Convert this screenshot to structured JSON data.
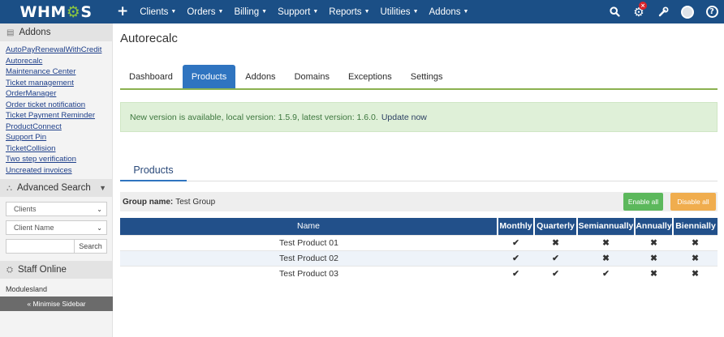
{
  "topbar": {
    "logo_prefix": "WHM",
    "logo_gear": "⚙",
    "logo_suffix": "S",
    "plus": "+",
    "menu": [
      {
        "label": "Clients",
        "caret": "▼"
      },
      {
        "label": "Orders",
        "caret": "▼"
      },
      {
        "label": "Billing",
        "caret": "▼"
      },
      {
        "label": "Support",
        "caret": "▼"
      },
      {
        "label": "Reports",
        "caret": "▼"
      },
      {
        "label": "Utilities",
        "caret": "▼"
      },
      {
        "label": "Addons",
        "caret": "▼"
      }
    ],
    "icons": [
      "search-icon",
      "gear-icon",
      "wrench-icon",
      "avatar",
      "help-icon"
    ],
    "search_glyph": "⚲",
    "gear_glyph": "⚙",
    "wrench_glyph": "✎",
    "help_glyph": "?",
    "notification_badge": "×"
  },
  "sidebar": {
    "addons_title": "Addons",
    "addons_icon": "▤",
    "addons": [
      "AutoPayRenewalWithCredit",
      "Autorecalc",
      "Maintenance Center",
      "Ticket management",
      "OrderManager",
      "Order ticket notification",
      "Ticket Payment Reminder",
      "ProductConnect",
      "Support Pin",
      "TicketCollision",
      "Two step verification",
      "Uncreated invoices"
    ],
    "advanced_search_title": "Advanced Search",
    "advanced_search_icon": "⛬",
    "collapse_glyph": "▼",
    "search_type": "Clients",
    "search_field": "Client Name",
    "dropdown_glyph": "⌄",
    "search_button": "Search",
    "staff_title": "Staff Online",
    "staff_icon": "⛭",
    "staff_members": [
      "Modulesland"
    ],
    "minimise_label": "« Minimise Sidebar"
  },
  "main": {
    "title": "Autorecalc",
    "tabs": [
      {
        "label": "Dashboard",
        "active": false
      },
      {
        "label": "Products",
        "active": true
      },
      {
        "label": "Addons",
        "active": false
      },
      {
        "label": "Domains",
        "active": false
      },
      {
        "label": "Exceptions",
        "active": false
      },
      {
        "label": "Settings",
        "active": false
      }
    ],
    "alert_text": "New version is available, local version: 1.5.9, latest version: 1.6.0.",
    "alert_link": "Update now",
    "section_tab": "Products",
    "group_label": "Group name:",
    "group_name": "Test Group",
    "enable_all": "Enable all",
    "disable_all": "Disable all",
    "table": {
      "columns": [
        "Name",
        "Monthly",
        "Quarterly",
        "Semiannually",
        "Annually",
        "Biennially"
      ],
      "rows": [
        {
          "name": "Test Product 01",
          "cells": [
            "✔",
            "✖",
            "✖",
            "✖",
            "✖"
          ]
        },
        {
          "name": "Test Product 02",
          "cells": [
            "✔",
            "✔",
            "✖",
            "✖",
            "✖"
          ]
        },
        {
          "name": "Test Product 03",
          "cells": [
            "✔",
            "✔",
            "✔",
            "✖",
            "✖"
          ]
        }
      ]
    }
  }
}
